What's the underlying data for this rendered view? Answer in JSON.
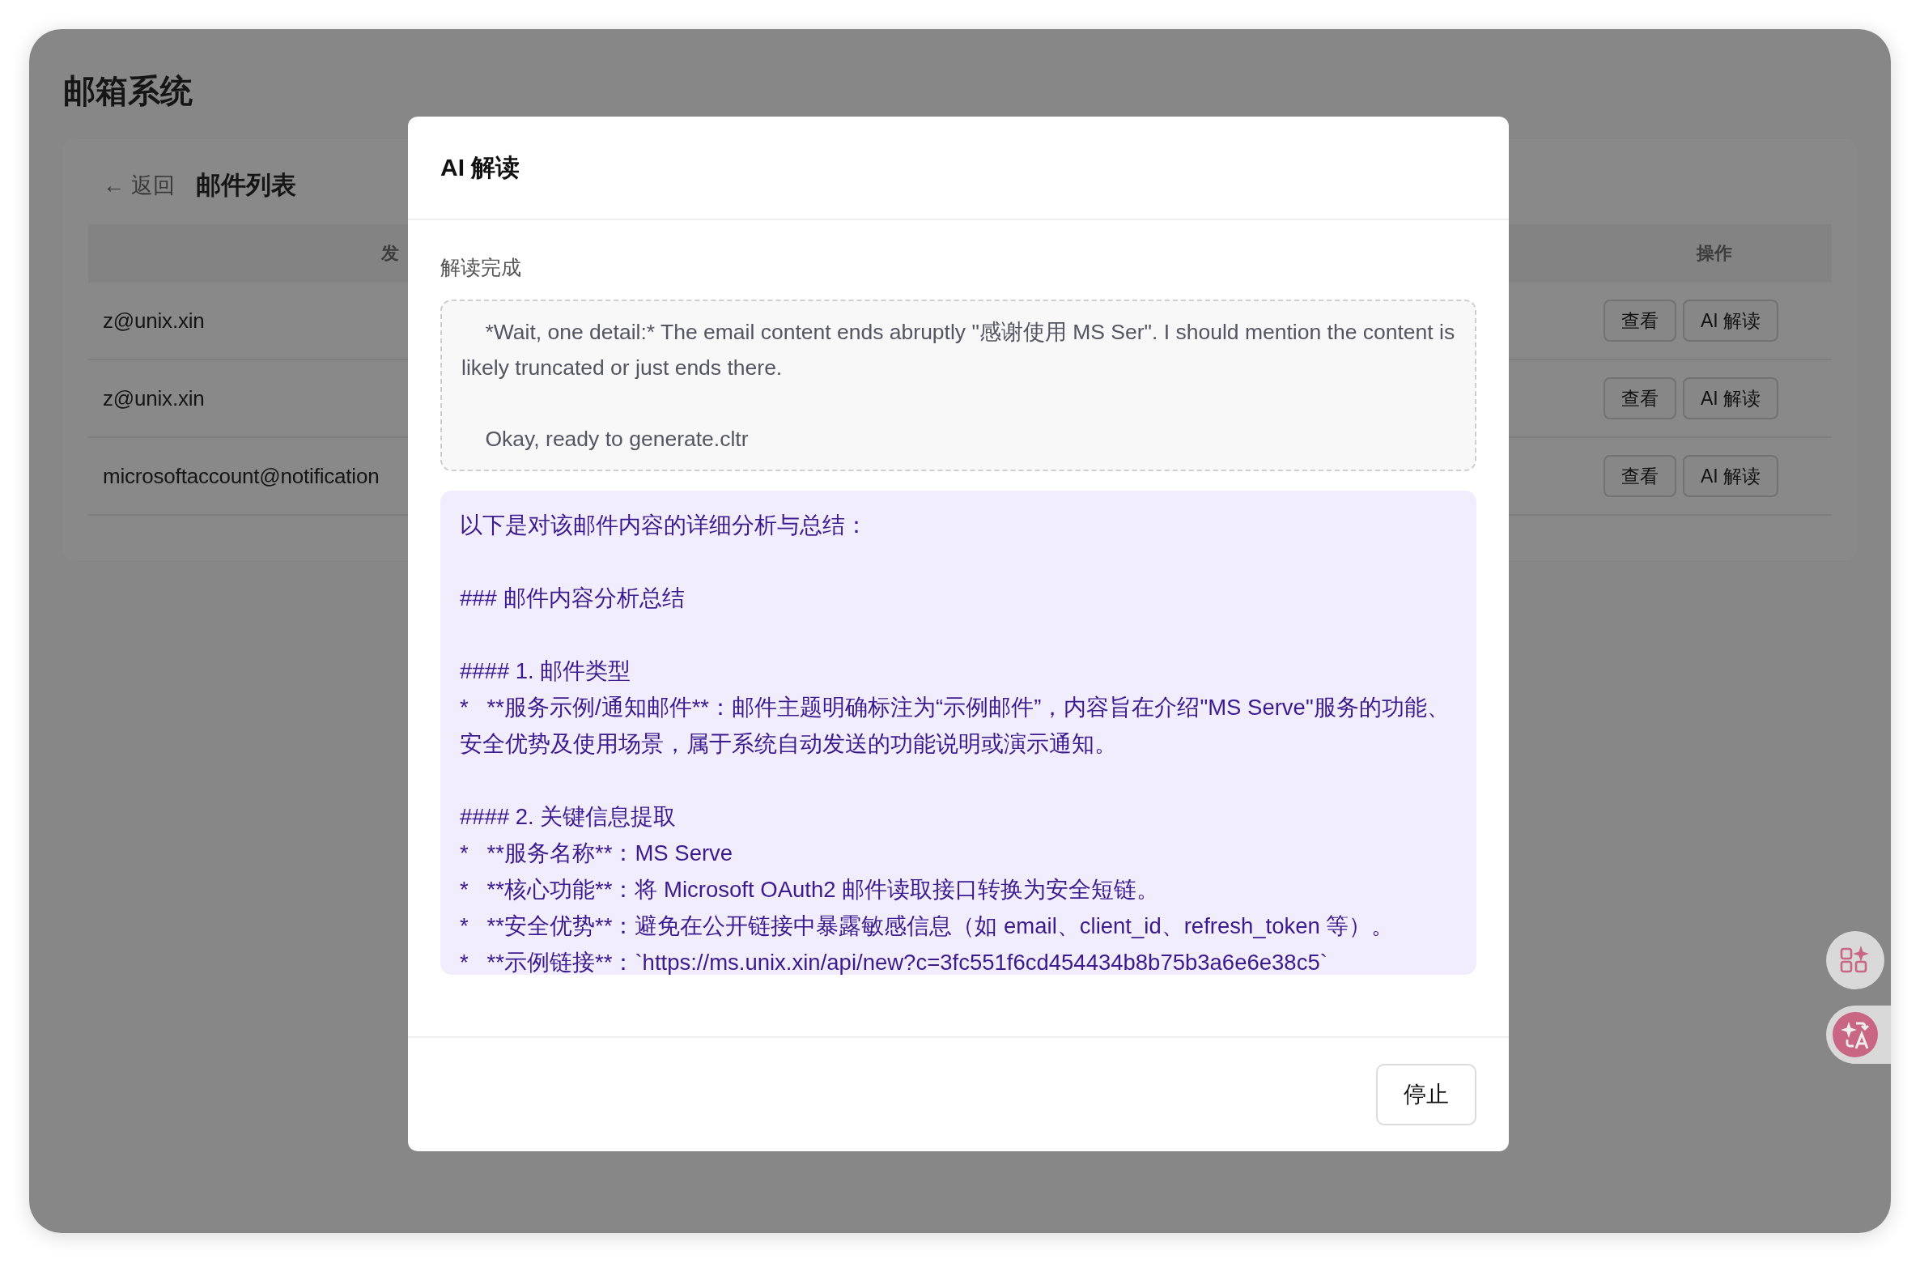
{
  "app": {
    "title": "邮箱系统"
  },
  "panel": {
    "back": {
      "arrow": "←",
      "label": "返回"
    },
    "title": "邮件列表",
    "table": {
      "columns": [
        "发",
        "操作"
      ],
      "rows": [
        {
          "sender": "z@unix.xin",
          "actions": [
            "查看",
            "AI 解读"
          ]
        },
        {
          "sender": "z@unix.xin",
          "actions": [
            "查看",
            "AI 解读"
          ]
        },
        {
          "sender": "microsoftaccount@notification",
          "actions": [
            "查看",
            "AI 解读"
          ]
        }
      ]
    }
  },
  "dialog": {
    "title": "AI 解读",
    "status": "解读完成",
    "thinking": [
      "    *Wait, one detail:* The email content ends abruptly \"感谢使用 MS Ser\". I should mention the content is likely truncated or just ends there.",
      "    Okay, ready to generate.cltr"
    ],
    "result": [
      [
        "以下是对该邮件内容的详细分析与总结："
      ],
      [
        "### 邮件内容分析总结"
      ],
      [
        "#### 1. 邮件类型",
        "*   **服务示例/通知邮件**：邮件主题明确标注为“示例邮件”，内容旨在介绍\"MS Serve\"服务的功能、安全优势及使用场景，属于系统自动发送的功能说明或演示通知。"
      ],
      [
        "#### 2. 关键信息提取",
        "*   **服务名称**：MS Serve",
        "*   **核心功能**：将 Microsoft OAuth2 邮件读取接口转换为安全短链。",
        "*   **安全优势**：避免在公开链接中暴露敏感信息（如 email、client_id、refresh_token 等）。",
        "*   **示例链接**：`https://ms.unix.xin/api/new?c=3fc551f6cd454434b8b75b3a6e6e38c5`"
      ]
    ],
    "buttons": [
      "停止"
    ]
  }
}
